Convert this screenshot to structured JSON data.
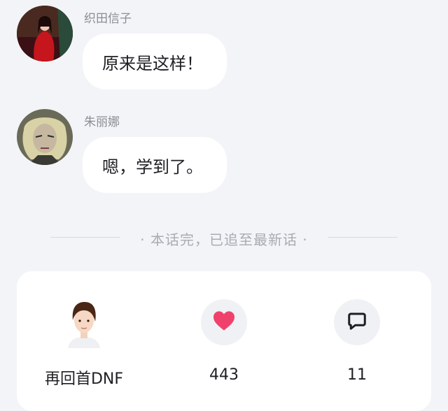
{
  "messages": [
    {
      "sender": "织田信子",
      "text": "原来是这样！"
    },
    {
      "sender": "朱丽娜",
      "text": "嗯，学到了。"
    }
  ],
  "divider_text": "· 本话完，已追至最新话 ·",
  "card": {
    "author_name": "再回首DNF",
    "likes": "443",
    "comments": "11"
  },
  "colors": {
    "background": "#f3f4f8",
    "bubble": "#ffffff",
    "heart": "#f0416c",
    "muted_text": "#8a8d94"
  },
  "icons": {
    "like": "heart-icon",
    "comment": "comment-icon"
  }
}
